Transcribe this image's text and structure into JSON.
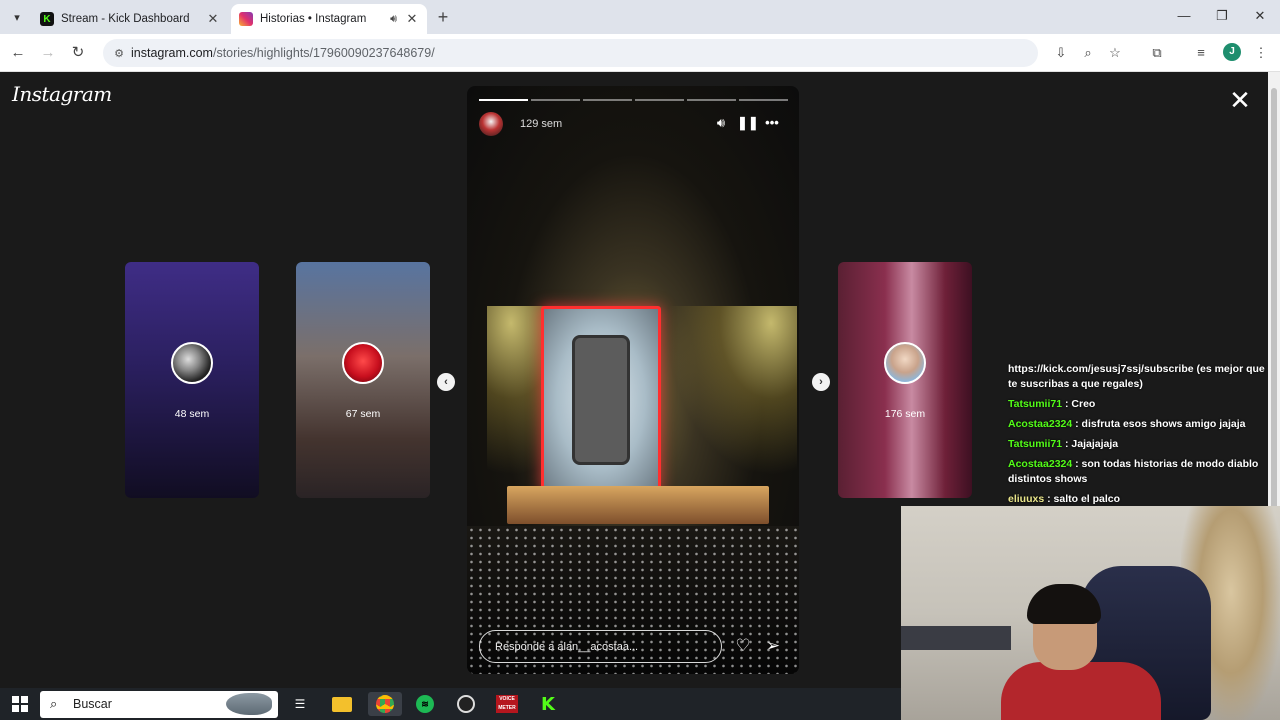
{
  "browser": {
    "tabs": [
      {
        "title": "Stream - Kick Dashboard",
        "favicon": "kick-icon"
      },
      {
        "title": "Historias • Instagram",
        "favicon": "instagram-icon",
        "audio": true
      }
    ],
    "url_host": "instagram.com",
    "url_path": "/stories/highlights/17960090237648679/",
    "profile_initial": "J"
  },
  "instagram": {
    "logo": "Instagram",
    "previews": [
      {
        "age": "48 sem"
      },
      {
        "age": "67 sem"
      },
      {
        "age": "176 sem"
      }
    ],
    "story": {
      "age": "129 sem",
      "segments": 6,
      "reply_placeholder": "Responde a alan__acostaa..."
    }
  },
  "chat": {
    "messages": [
      {
        "user": "",
        "text": "https://kick.com/jesusj7ssj/subscribe (es mejor que te suscribas a que regales)"
      },
      {
        "user": "Tatsumii71",
        "text": " : Creo"
      },
      {
        "user": "Acostaa2324",
        "text": " : disfruta esos shows amigo jajaja"
      },
      {
        "user": "Tatsumii71",
        "text": " : Jajajajaja"
      },
      {
        "user": "Acostaa2324",
        "text": " : son todas historias de modo diablo distintos shows"
      },
      {
        "user": "eliuuxs",
        "text": " : salto el palco"
      }
    ]
  },
  "taskbar": {
    "search_placeholder": "Buscar",
    "voicemeeter_label": "VOICE METER"
  },
  "colors": {
    "kick_green": "#53fc18",
    "page_bg": "#1a1a1a"
  }
}
